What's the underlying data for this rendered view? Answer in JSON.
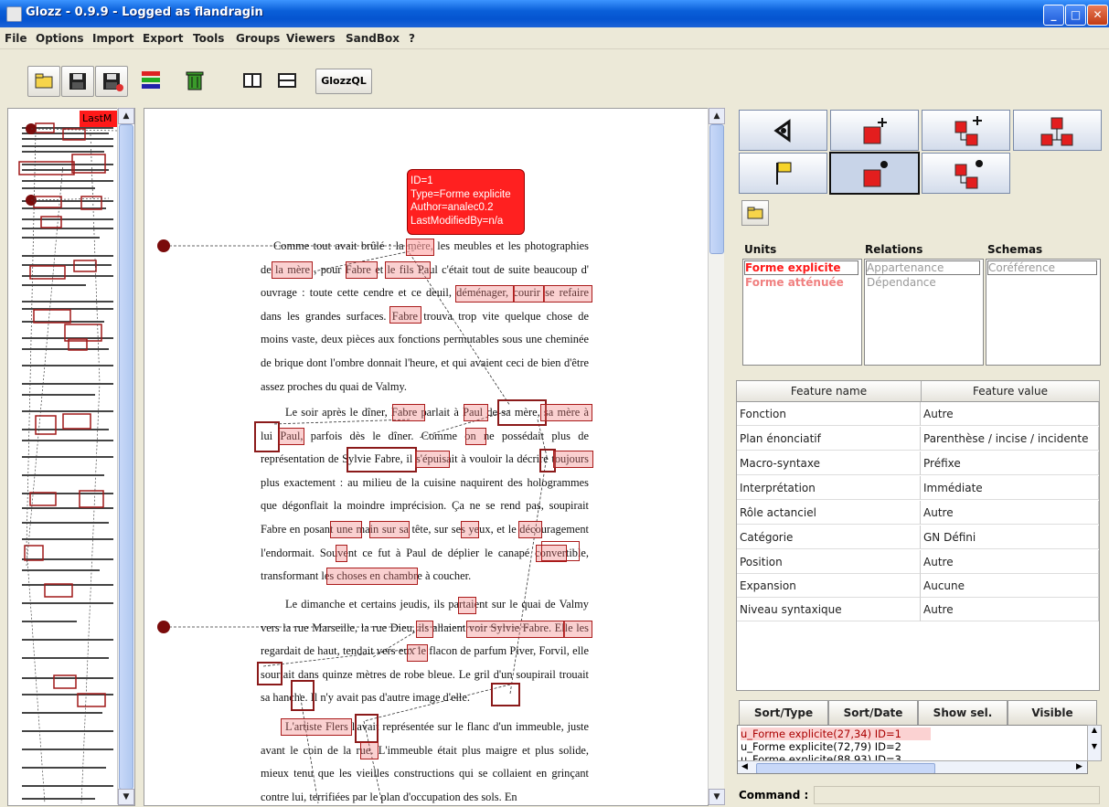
{
  "window": {
    "title": "Glozz - 0.9.9 - Logged as flandragin"
  },
  "menu": [
    "File",
    "Options",
    "Import",
    "Export",
    "Tools",
    "Groups",
    "Viewers",
    "SandBox",
    "?"
  ],
  "toolbar": {
    "query_label": "GlozzQL"
  },
  "minimap": {
    "tag": "LastM"
  },
  "info": {
    "line1": "ID=1",
    "line2": "Type=Forme explicite",
    "line3": "Author=analec0.2",
    "line4": "LastModifiedBy=n/a"
  },
  "text": {
    "p1": "Comme tout avait brûlé : la mère, les meubles et les photographies de la mère , pour Fabre et le fils Paul c'était tout de suite beaucoup d' ouvrage : toute cette cendre et ce deuil, déménager, courir se refaire dans les grandes surfaces. Fabre trouva trop vite quelque chose de moins vaste, deux pièces aux fonctions permutables sous une cheminée de brique dont l'ombre donnait l'heure, et qui avaient ceci de bien d'être assez proches du quai de Valmy.",
    "p2": "Le soir après le dîner, Fabre parlait à Paul de sa mère, sa mère à lui Paul, parfois dès le dîner. Comme on ne possédait plus de représentation de Sylvie Fabre, il s'épuisait à vouloir la décrire toujours plus exactement : au milieu de la cuisine naquirent des hologrammes que dégonflait la moindre imprécision. Ça ne se rend pas, soupirait Fabre en posant une main sur sa tête, sur ses yeux, et le découragement l'endormait. Souvent ce fut à Paul de déplier le canapé convertible, transformant les choses en chambre à coucher.",
    "p3": "Le dimanche et certains jeudis, ils partaient sur le quai de Valmy vers la rue Marseille, la rue Dieu, ils allaient voir Sylvie Fabre. Elle les regardait de haut, tendait vers eux le flacon de parfum Piver, Forvil, elle souriait dans quinze mètres de robe bleue. Le gril d'un soupirail trouait sa hanche. Il n'y avait pas d'autre image d'elle.",
    "p4": "L'artiste Flers l'avait représentée sur le flanc d'un immeuble, juste avant le coin de la rue. L'immeuble était plus maigre et plus solide, mieux tenu que les vieilles constructions qui se collaient en grinçant contre lui, terrifiées par le plan d'occupation des sols. En"
  },
  "tabs": {
    "units": "Units",
    "relations": "Relations",
    "schemas": "Schemas"
  },
  "units": [
    "Forme explicite",
    "Forme atténuée"
  ],
  "relations": [
    "Appartenance",
    "Dépendance"
  ],
  "schemas": [
    "Coréférence"
  ],
  "features": {
    "header_name": "Feature name",
    "header_value": "Feature value",
    "rows": [
      {
        "name": "Fonction",
        "value": "Autre"
      },
      {
        "name": "Plan énonciatif",
        "value": "Parenthèse / incise / incidente"
      },
      {
        "name": "Macro-syntaxe",
        "value": "Préfixe"
      },
      {
        "name": "Interprétation",
        "value": "Immédiate"
      },
      {
        "name": "Rôle actanciel",
        "value": "Autre"
      },
      {
        "name": "Catégorie",
        "value": "GN Défini"
      },
      {
        "name": "Position",
        "value": "Autre"
      },
      {
        "name": "Expansion",
        "value": "Aucune"
      },
      {
        "name": "Niveau syntaxique",
        "value": "Autre"
      }
    ]
  },
  "sort_buttons": [
    "Sort/Type",
    "Sort/Date",
    "Show sel.",
    "Visible"
  ],
  "unit_list": [
    "u_Forme explicite(27,34) ID=1",
    "u_Forme explicite(72,79) ID=2",
    "u_Forme explicite(88,93) ID=3"
  ],
  "command": {
    "label": "Command :"
  },
  "colors": {
    "unit_selected": "#ff1a1a",
    "unit_light": "#f08080",
    "annotation": "#ff2020"
  }
}
